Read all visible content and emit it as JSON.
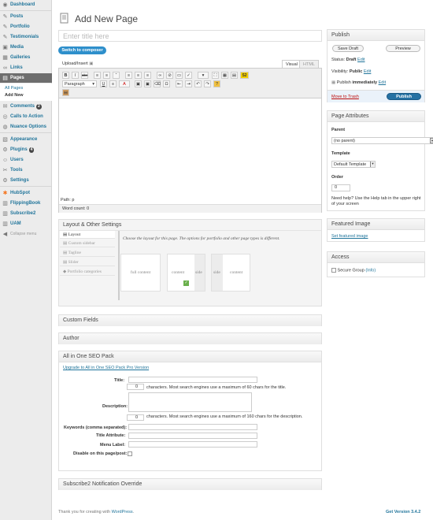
{
  "sidebar": {
    "dashboard": "Dashboard",
    "posts": "Posts",
    "portfolio": "Portfolio",
    "testimonials": "Testimonials",
    "media": "Media",
    "galleries": "Galleries",
    "links": "Links",
    "pages": "Pages",
    "all_pages": "All Pages",
    "add_new": "Add New",
    "comments": "Comments",
    "comments_count": "2",
    "calls_to_action": "Calls to Action",
    "nuance_options": "Nuance Options",
    "appearance": "Appearance",
    "plugins": "Plugins",
    "plugins_count": "4",
    "users": "Users",
    "tools": "Tools",
    "settings": "Settings",
    "hubspot": "HubSpot",
    "flippingbook": "FlippingBook",
    "subscribe2": "Subscribe2",
    "uam": "UAM",
    "collapse": "Collapse menu"
  },
  "header": {
    "title": "Add New Page"
  },
  "title_input": {
    "placeholder": "Enter title here"
  },
  "composer": {
    "label": "Switch to composer"
  },
  "editor": {
    "upload_insert": "Upload/Insert",
    "tab_visual": "Visual",
    "tab_html": "HTML",
    "paragraph": "Paragraph",
    "path": "Path: p",
    "word_count": "Word count: 0",
    "tb_bold": "B",
    "tb_italic": "I",
    "tb_strike": "abc",
    "tb_omega": "Ω",
    "tb_help": "?",
    "tb_s2": "S2",
    "tb_underline": "U",
    "tb_textcolor": "A",
    "tb_undo": "↶",
    "tb_redo": "↷",
    "tb_quote": "“"
  },
  "publish": {
    "title": "Publish",
    "save_draft": "Save Draft",
    "preview": "Preview",
    "status_label": "Status:",
    "status_value": "Draft",
    "visibility_label": "Visibility:",
    "visibility_value": "Public",
    "publish_label": "Publish",
    "publish_value": "immediately",
    "edit": "Edit",
    "trash": "Move to Trash",
    "publish_button": "Publish"
  },
  "attributes": {
    "title": "Page Attributes",
    "parent_label": "Parent",
    "parent_value": "(no parent)",
    "template_label": "Template",
    "template_value": "Default Template",
    "order_label": "Order",
    "order_value": "0",
    "help": "Need help? Use the Help tab in the upper right of your screen"
  },
  "featured": {
    "title": "Featured Image",
    "link": "Set featured image"
  },
  "access": {
    "title": "Access",
    "secure_group": "Secure Group",
    "info": "(Info)"
  },
  "layout_box": {
    "title": "Layout & Other Settings",
    "tabs": [
      "Layout",
      "Custom sidebar",
      "Tagline",
      "Slider",
      "Portfolio categories"
    ],
    "description": "Choose the layout for this page. The options for portfolio and other page types is different.",
    "full_content": "full content",
    "content": "content",
    "side": "side",
    "side2": "side",
    "content2": "content"
  },
  "custom_fields": {
    "title": "Custom Fields"
  },
  "author": {
    "title": "Author"
  },
  "seo": {
    "title": "All in One SEO Pack",
    "upgrade": "Upgrade to All in One SEO Pack Pro Version",
    "title_label": "Title:",
    "title_count": "0",
    "title_hint": "characters. Most search engines use a maximum of 60 chars for the title.",
    "description_label": "Description:",
    "desc_count": "0",
    "desc_hint": "characters. Most search engines use a maximum of 160 chars for the description.",
    "keywords_label": "Keywords (comma separated):",
    "title_attr_label": "Title Attribute:",
    "menu_label": "Menu Label:",
    "disable_label": "Disable on this page/post:"
  },
  "subscribe2_override": {
    "title": "Subscribe2 Notification Override"
  },
  "footer": {
    "thanks_prefix": "Thank you for creating with",
    "thanks_link": "WordPress",
    "version": "Get Version 3.4.2"
  }
}
